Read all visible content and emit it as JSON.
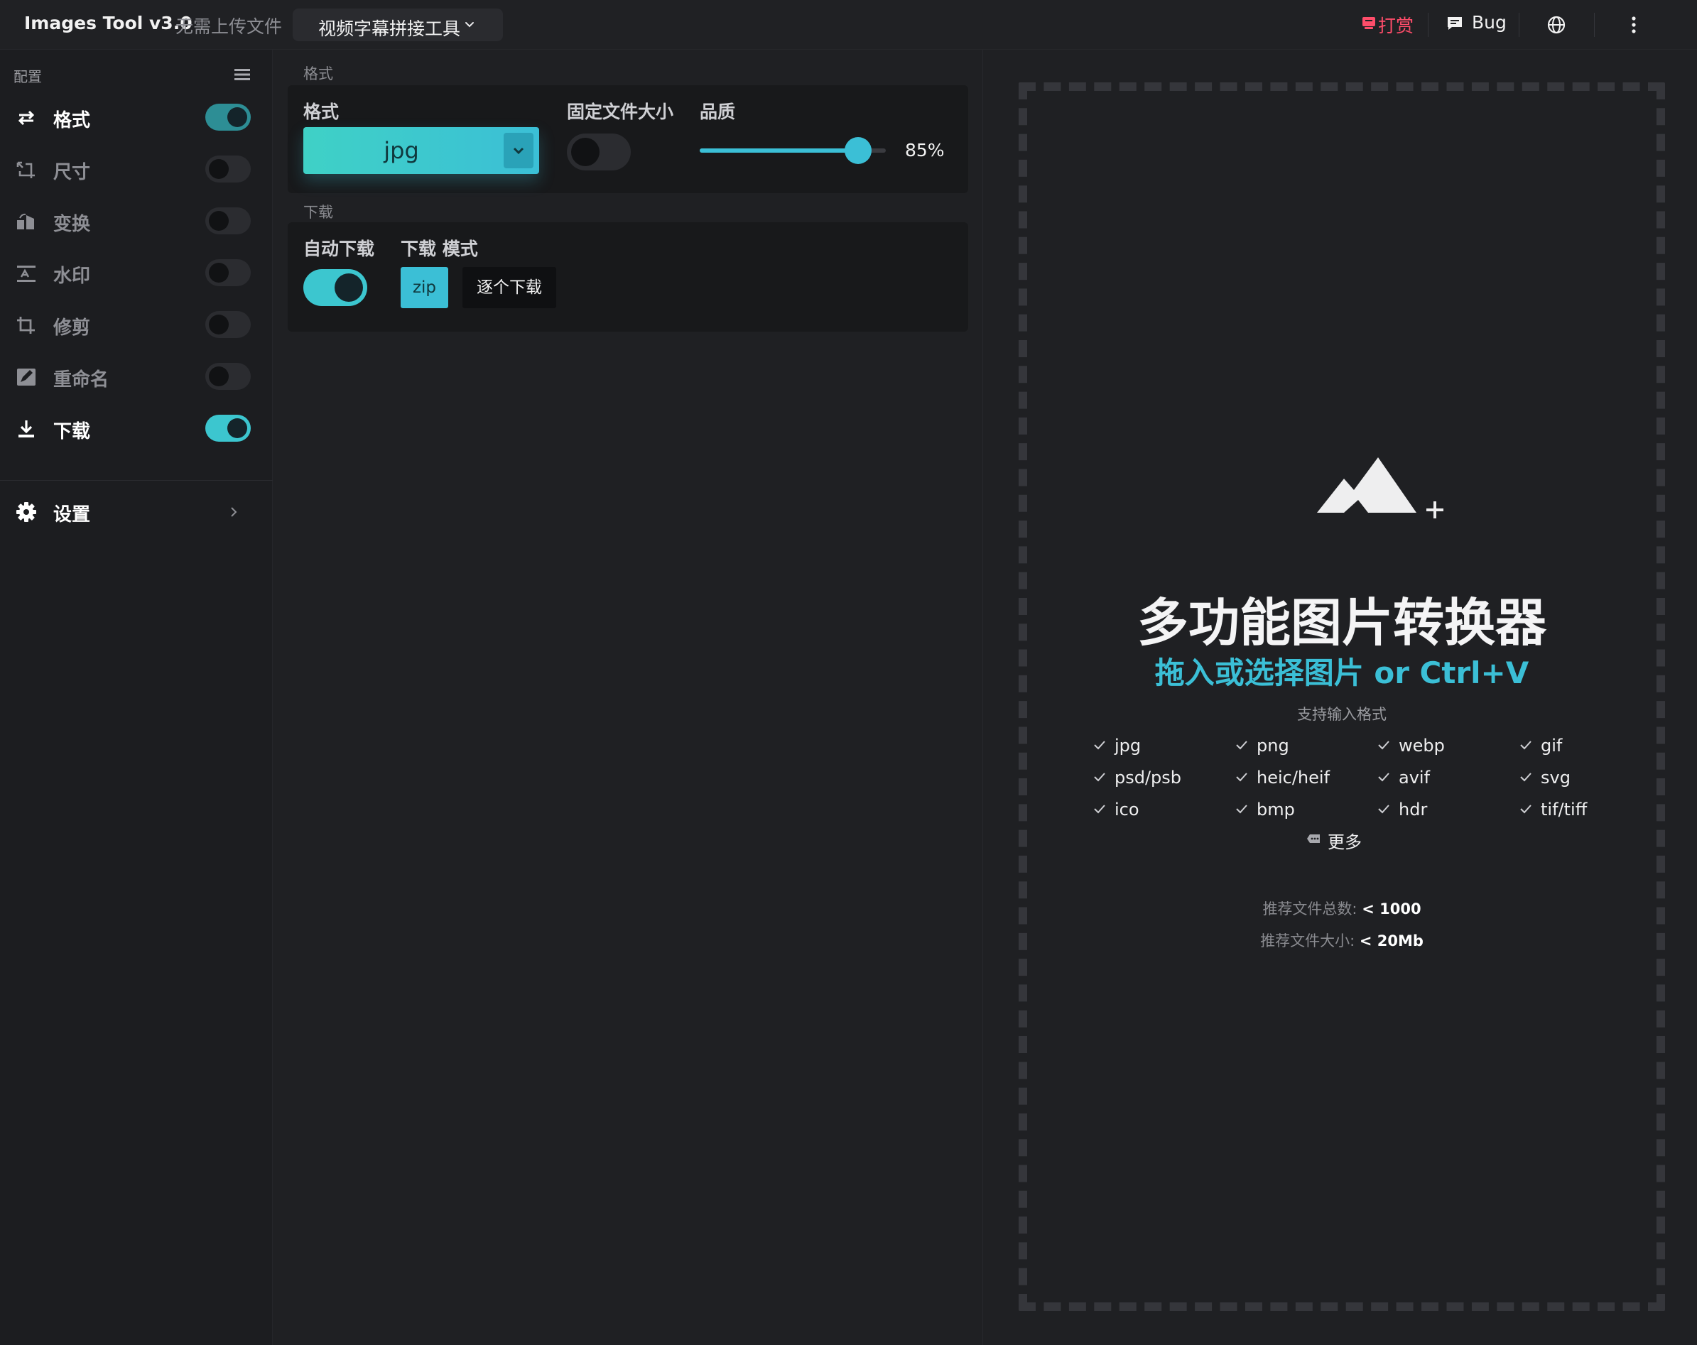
{
  "header": {
    "app_title": "Images Tool v3.0",
    "app_subtitle": "无需上传文件",
    "tool_selector": "视频字幕拼接工具",
    "donate_label": "打赏",
    "bug_label": "Bug",
    "colors": {
      "donate": "#ff4d6a",
      "accent": "#3bbfd6"
    }
  },
  "sidebar": {
    "header": "配置",
    "items": [
      {
        "label": "格式",
        "icon": "swap-arrows-icon",
        "enabled": true
      },
      {
        "label": "尺寸",
        "icon": "resize-icon",
        "enabled": false
      },
      {
        "label": "变换",
        "icon": "transform-icon",
        "enabled": false
      },
      {
        "label": "水印",
        "icon": "watermark-icon",
        "enabled": false
      },
      {
        "label": "修剪",
        "icon": "crop-icon",
        "enabled": false
      },
      {
        "label": "重命名",
        "icon": "rename-icon",
        "enabled": false
      },
      {
        "label": "下载",
        "icon": "download-icon",
        "enabled": true
      }
    ],
    "settings_label": "设置"
  },
  "format_section": {
    "section_title": "格式",
    "format_label": "格式",
    "format_value": "jpg",
    "fixed_size_label": "固定文件大小",
    "fixed_size_enabled": false,
    "quality_label": "品质",
    "quality_value": "85%",
    "quality_percent": 85
  },
  "download_section": {
    "section_title": "下载",
    "auto_download_label": "自动下载",
    "auto_download_enabled": true,
    "mode_label": "下载 模式",
    "mode_zip": "zip",
    "mode_each": "逐个下载",
    "selected_mode": "zip"
  },
  "dropzone": {
    "title": "多功能图片转换器",
    "subtitle": "拖入或选择图片 or Ctrl+V",
    "formats_header": "支持输入格式",
    "formats": [
      "jpg",
      "png",
      "webp",
      "gif",
      "psd/psb",
      "heic/heif",
      "avif",
      "svg",
      "ico",
      "bmp",
      "hdr",
      "tif/tiff"
    ],
    "more_label": "更多",
    "rec_count_label": "推荐文件总数:",
    "rec_count_value": "< 1000",
    "rec_size_label": "推荐文件大小:",
    "rec_size_value": "< 20Mb"
  }
}
